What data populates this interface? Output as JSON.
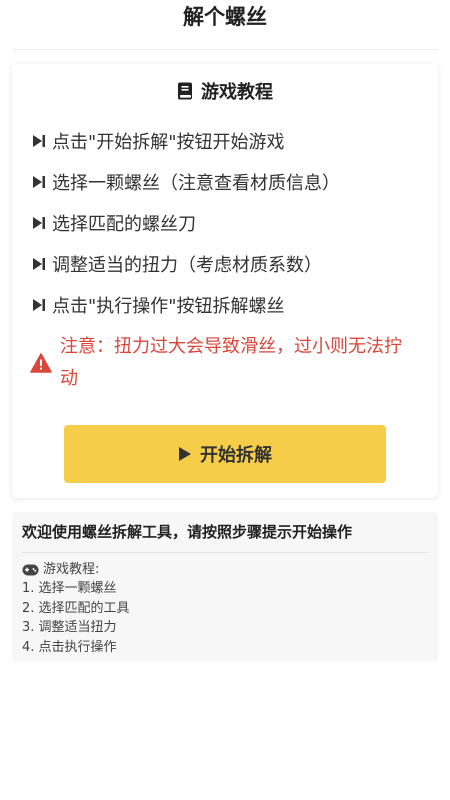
{
  "header": {
    "title": "解个螺丝"
  },
  "tutorial": {
    "title": "游戏教程",
    "book_icon": "book-icon",
    "step_icon": "step-forward-icon",
    "steps": [
      "点击\"开始拆解\"按钮开始游戏",
      "选择一颗螺丝（注意查看材质信息）",
      "选择匹配的螺丝刀",
      "调整适当的扭力（考虑材质系数）",
      "点击\"执行操作\"按钮拆解螺丝"
    ],
    "warning": "注意：扭力过大会导致滑丝，过小则无法拧动",
    "warning_icon": "warning-triangle-icon",
    "start_button": "开始拆解",
    "start_icon": "play-icon"
  },
  "info": {
    "welcome": "欢迎使用螺丝拆解工具，请按照步骤提示开始操作",
    "tutorial_label": "游戏教程:",
    "gamepad_icon": "gamepad-icon",
    "steps": [
      "1. 选择一颗螺丝",
      "2. 选择匹配的工具",
      "3. 调整适当扭力",
      "4. 点击执行操作"
    ]
  },
  "colors": {
    "accent": "#f5cd49",
    "warning": "#d9463a",
    "panel_bg": "#f7f7f8"
  }
}
